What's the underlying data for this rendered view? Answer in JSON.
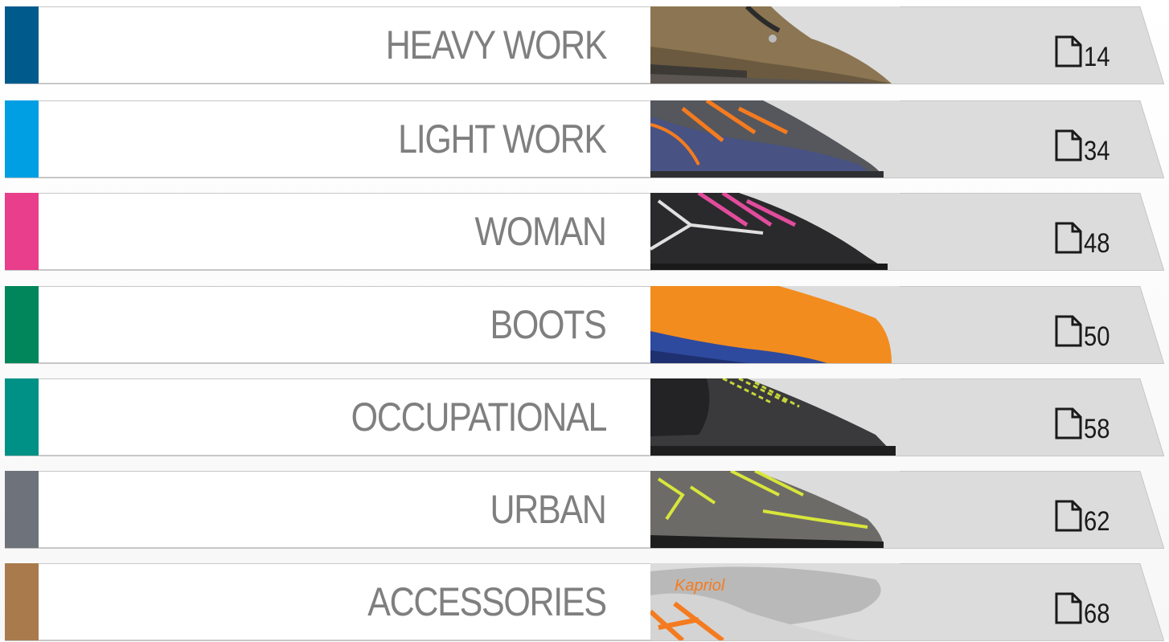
{
  "categories": [
    {
      "label": "HEAVY WORK",
      "page": "14",
      "color": "#005b8c",
      "icon": "document-icon",
      "image": "brown-leather-work-shoe"
    },
    {
      "label": "LIGHT WORK",
      "page": "34",
      "color": "#009fe3",
      "icon": "document-icon",
      "image": "grey-orange-mesh-shoe"
    },
    {
      "label": "WOMAN",
      "page": "48",
      "color": "#e83e8c",
      "icon": "document-icon",
      "image": "black-pink-shoe"
    },
    {
      "label": "BOOTS",
      "page": "50",
      "color": "#00865a",
      "icon": "document-icon",
      "image": "orange-rubber-boot"
    },
    {
      "label": "OCCUPATIONAL",
      "page": "58",
      "color": "#009186",
      "icon": "document-icon",
      "image": "black-knit-shoe"
    },
    {
      "label": "URBAN",
      "page": "62",
      "color": "#6e737b",
      "icon": "document-icon",
      "image": "grey-yellow-urban-shoe"
    },
    {
      "label": "ACCESSORIES",
      "page": "68",
      "color": "#a97a4b",
      "icon": "document-icon",
      "image": "orange-insole"
    }
  ]
}
